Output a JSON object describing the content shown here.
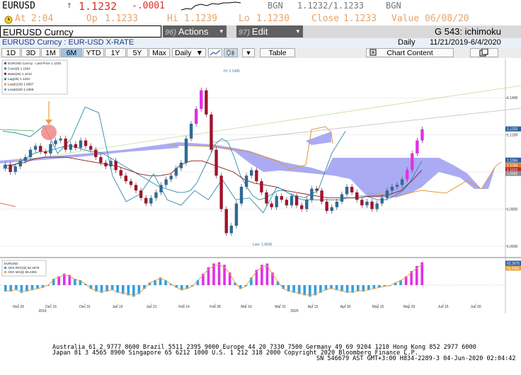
{
  "header": {
    "ticker": "EURUSD",
    "arrow": "↑",
    "last": "1.1232",
    "change": "-.0001",
    "bgn_label": "BGN",
    "bid_ask": "1.1232/1.1233",
    "bgn2": "BGN",
    "at_label": "At",
    "time": "2:04",
    "op_label": "Op",
    "open": "1.1233",
    "hi_label": "Hi",
    "high": "1.1239",
    "lo_label": "Lo",
    "low": "1.1230",
    "close_label": "Close",
    "close": "1.1233",
    "value_label": "Value",
    "value_date": "06/08/20"
  },
  "menu": {
    "security": "EURUSD Curncy",
    "actions_num": "96)",
    "actions": "Actions",
    "edit_num": "97)",
    "edit": "Edit",
    "page": "G 543: ichimoku"
  },
  "subheader": {
    "desc": "EURUSD Curncy : EUR-USD X-RATE",
    "period": "Daily",
    "range": "11/21/2019-6/4/2020"
  },
  "toolbar": {
    "ranges": [
      "1D",
      "3D",
      "1M",
      "6M",
      "YTD",
      "1Y",
      "5Y",
      "Max"
    ],
    "selected": "6M",
    "freq": "Daily",
    "table": "Table",
    "chart_content": "Chart Content"
  },
  "chart_data": [
    {
      "type": "line",
      "title": "",
      "legend": [
        "EURUSD Curncy - Last Price 1.1232",
        "Conv(9)  1.1064",
        "Base(26)  1.1012",
        "Lag(26)  1.1232",
        "Lead1(26)  1.0897",
        "Lead2(26)  1.1065"
      ],
      "y_ticks": [
        "1.1400",
        "1.1200",
        "1.1000",
        "1.0800",
        "1.0600"
      ],
      "ylim": [
        1.055,
        1.158
      ],
      "annotations": [
        "Hi: 1.1495",
        "Low: 1.0636"
      ],
      "price_tags": [
        {
          "value": "1.1232",
          "color": "#2f5fa0"
        },
        {
          "value": "1.1064",
          "color": "#2f5fa0"
        },
        {
          "value": "1.1036",
          "color": "#e08030"
        },
        {
          "value": "1.1012",
          "color": "#c0282c"
        },
        {
          "value": "1.0992",
          "color": "#8c8c8c"
        }
      ],
      "series": [
        {
          "name": "Close",
          "values": [
            1.104,
            1.1,
            1.103,
            1.106,
            1.108,
            1.112,
            1.114,
            1.111,
            1.11,
            1.115,
            1.117,
            1.118,
            1.112,
            1.115,
            1.113,
            1.117,
            1.114,
            1.112,
            1.108,
            1.105,
            1.103,
            1.106,
            1.101,
            1.098,
            1.095,
            1.093,
            1.09,
            1.086,
            1.083,
            1.086,
            1.089,
            1.093,
            1.096,
            1.098,
            1.102,
            1.105,
            1.118,
            1.126,
            1.134,
            1.144,
            1.131,
            1.112,
            1.098,
            1.08,
            1.067,
            1.071,
            1.083,
            1.092,
            1.098,
            1.101,
            1.095,
            1.089,
            1.083,
            1.081,
            1.087,
            1.085,
            1.082,
            1.087,
            1.082,
            1.08,
            1.085,
            1.091,
            1.09,
            1.084,
            1.079,
            1.081,
            1.084,
            1.088,
            1.092,
            1.089,
            1.085,
            1.082,
            1.084,
            1.08,
            1.083,
            1.086,
            1.09,
            1.092,
            1.093,
            1.096,
            1.101,
            1.11,
            1.117,
            1.123
          ]
        },
        {
          "name": "Conv(9)",
          "values": [
            1.102,
            1.102,
            1.104,
            1.106,
            1.108,
            1.11,
            1.111,
            1.111,
            1.112,
            1.113,
            1.114,
            1.114,
            1.113,
            1.112,
            1.111,
            1.111,
            1.11,
            1.108,
            1.106,
            1.104,
            1.102,
            1.1,
            1.098,
            1.096,
            1.094,
            1.092,
            1.091,
            1.09,
            1.089,
            1.089,
            1.09,
            1.094,
            1.101,
            1.108,
            1.115,
            1.118,
            1.116,
            1.108,
            1.098,
            1.092,
            1.087,
            1.085,
            1.086,
            1.088,
            1.09,
            1.09,
            1.088,
            1.086,
            1.085,
            1.085,
            1.085,
            1.085,
            1.085,
            1.085,
            1.085,
            1.086,
            1.086,
            1.087,
            1.087,
            1.086,
            1.085,
            1.085,
            1.086,
            1.088,
            1.09,
            1.094,
            1.1,
            1.106
          ]
        },
        {
          "name": "Base(26)",
          "values": [
            1.103,
            1.104,
            1.105,
            1.107,
            1.108,
            1.108,
            1.108,
            1.107,
            1.106,
            1.105,
            1.104,
            1.103,
            1.101,
            1.099,
            1.098,
            1.098,
            1.099,
            1.104,
            1.106,
            1.106,
            1.104,
            1.102,
            1.1,
            1.096,
            1.094,
            1.093,
            1.092,
            1.09,
            1.089,
            1.088,
            1.087,
            1.086,
            1.086,
            1.086,
            1.086,
            1.087,
            1.087,
            1.088,
            1.09,
            1.095,
            1.101
          ]
        },
        {
          "name": "Lag(26)",
          "values": [
            1.122,
            1.121,
            1.119,
            1.125,
            1.11,
            1.118,
            1.135,
            1.132,
            1.098,
            1.084,
            1.088,
            1.099,
            1.085,
            1.082,
            1.09,
            1.085,
            1.096,
            1.085,
            1.086,
            1.078,
            1.092,
            1.088,
            1.086,
            1.09,
            1.11,
            1.122
          ]
        }
      ]
    },
    {
      "type": "bar",
      "title": "EURUSD",
      "legend": [
        "ADX ROC(5)  62.2675",
        "ADX MA(5)  56.4391"
      ],
      "tags": [
        "62.2675",
        "56.4391"
      ],
      "x_tick_labels": [
        "Nov 29",
        "Dec 16",
        "Dec 31",
        "Jan 15",
        "Jan 31",
        "Feb 14",
        "Feb 28",
        "Mar 16",
        "Mar 31",
        "Apr 15",
        "Apr 30",
        "May 15",
        "May 29",
        "Jun 15",
        "Jun 30"
      ],
      "year_labels": [
        "2019",
        "2020"
      ],
      "values": [
        -10,
        -10,
        -8,
        -12,
        -10,
        -8,
        -6,
        -4,
        0,
        10,
        14,
        18,
        16,
        10,
        8,
        2,
        -6,
        -10,
        -12,
        -10,
        -8,
        -12,
        -14,
        -16,
        -18,
        -14,
        -6,
        4,
        8,
        12,
        8,
        2,
        -4,
        -8,
        -6,
        -2,
        8,
        18,
        28,
        34,
        36,
        32,
        20,
        4,
        -6,
        -2,
        12,
        24,
        32,
        34,
        20,
        6,
        -6,
        -10,
        -12,
        -14,
        -16,
        -18,
        -16,
        -12,
        -8,
        -6,
        -8,
        -10,
        -12,
        -12,
        -10,
        -10,
        -8,
        -6,
        -4,
        -2,
        -1,
        4,
        8,
        14,
        22,
        30,
        36
      ]
    }
  ],
  "footer": {
    "line1": "Australia 61 2 9777 8600 Brazil 5511 2395 9000 Europe 44 20 7330 7500 Germany 49 69 9204 1210 Hong Kong 852 2977 6000",
    "line2": "Japan 81 3 4565 8900        Singapore 65 6212 1000        U.S. 1 212 318 2000        Copyright 2020 Bloomberg Finance L.P.",
    "line3": "SN 546679 AST  GMT+3:00 H834-2289-3 04-Jun-2020 02:04:42"
  },
  "colors": {
    "bull_candle": "#2f6a96",
    "bear_candle": "#a0152b",
    "highlight_candle": "#e030e8",
    "cloud": "#8f8ff0",
    "conv": "#2b8aa8",
    "base": "#8b1a1a",
    "lead1": "#e0983a",
    "lag": "#2b8aa8",
    "roc_bar": "#2fa0e0",
    "roc_bar_pos": "#e030e8",
    "adx_ma": "#e8a040"
  }
}
